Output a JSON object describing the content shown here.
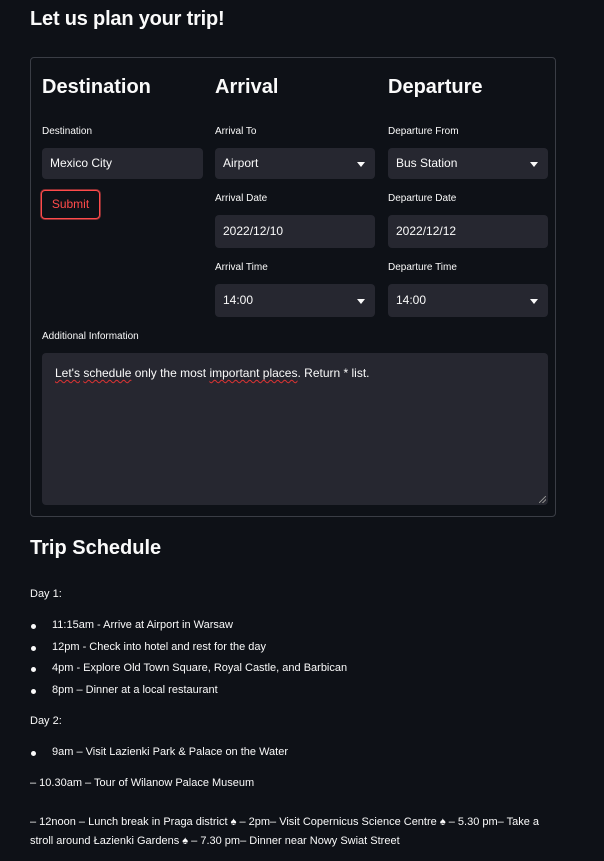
{
  "page": {
    "title": "Let us plan your trip!"
  },
  "form": {
    "destination": {
      "heading": "Destination",
      "label": "Destination",
      "value": "Mexico City"
    },
    "submit_label": "Submit",
    "arrival": {
      "heading": "Arrival",
      "to_label": "Arrival To",
      "to_value": "Airport",
      "date_label": "Arrival Date",
      "date_value": "2022/12/10",
      "time_label": "Arrival Time",
      "time_value": "14:00"
    },
    "departure": {
      "heading": "Departure",
      "from_label": "Departure From",
      "from_value": "Bus Station",
      "date_label": "Departure Date",
      "date_value": "2022/12/12",
      "time_label": "Departure Time",
      "time_value": "14:00"
    },
    "additional": {
      "label": "Additional Information",
      "text_a": "Let's",
      "text_b": "schedule",
      "text_c": "only the most",
      "text_d": "important places",
      "text_e": ". Return * list."
    }
  },
  "schedule": {
    "title": "Trip Schedule",
    "day1": {
      "label": "Day 1:",
      "items": [
        "11:15am - Arrive at Airport in Warsaw",
        "12pm - Check into hotel and rest for the day",
        "4pm - Explore Old Town Square, Royal Castle, and Barbican",
        "8pm – Dinner at a local restaurant"
      ]
    },
    "day2": {
      "label": "Day 2:",
      "items": [
        "9am – Visit Lazienki Park & Palace on the Water"
      ],
      "line1": "– 10.30am – Tour of Wilanow Palace Museum",
      "line2_a": "– 12noon – Lunch break in Praga district ",
      "line2_b": " – 2pm– Visit Copernicus Science Centre ",
      "line2_c": " – 5.30 pm– Take a",
      "line3_a": "stroll around Łazienki Gardens ",
      "line3_b": " – 7.30 pm– Dinner near Nowy Swiat Street",
      "emoji_icon": "♠"
    }
  }
}
